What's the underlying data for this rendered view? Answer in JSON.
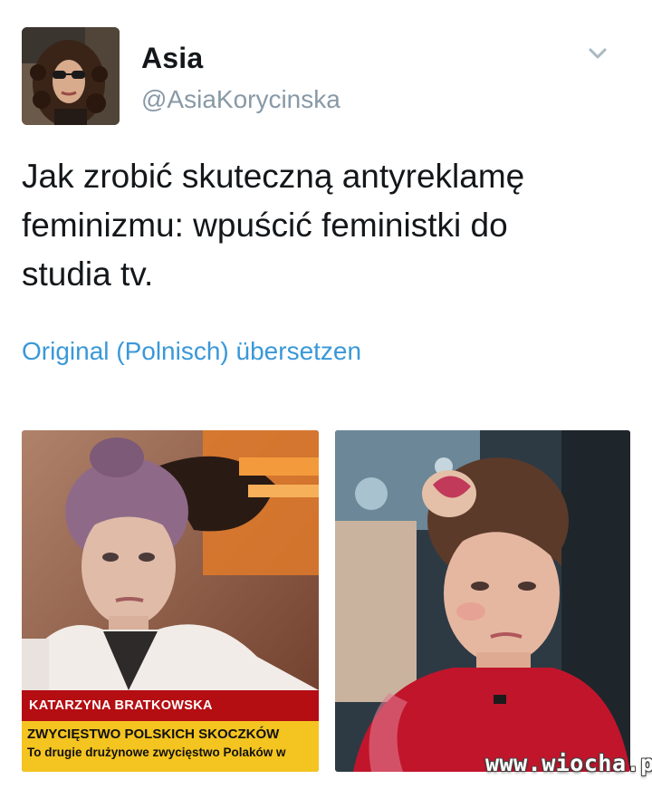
{
  "author": {
    "display_name": "Asia",
    "handle": "@AsiaKorycinska",
    "avatar_icon": "profile-photo"
  },
  "tweet": {
    "text": "Jak zrobić skuteczną antyreklamę\nfeminizmu: wpuścić feministki do\nstudia tv.",
    "translate_label": "Original (Polnisch) übersetzen"
  },
  "media": {
    "left_image": {
      "name_bar": "KATARZYNA BRATKOWSKA",
      "ticker_headline": "ZWYCIĘSTWO POLSKICH SKOCZKÓW",
      "ticker_sub": "To drugie drużynowe zwycięstwo Polaków w"
    },
    "right_image": {}
  },
  "watermark": "www.wiocha.pl",
  "colors": {
    "link": "#3a98d8",
    "handle": "#8899a6",
    "text": "#14171a",
    "tv_red": "#b40d12",
    "tv_yellow": "#f4c420"
  },
  "icons": {
    "menu": "chevron-down-icon"
  }
}
